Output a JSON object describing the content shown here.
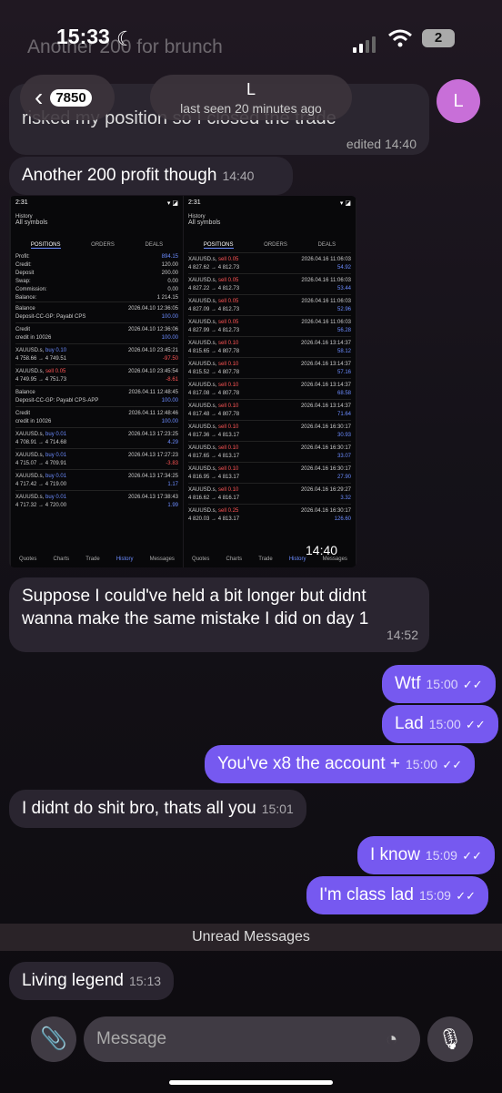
{
  "status": {
    "time": "15:33",
    "battery": "2"
  },
  "header": {
    "back_badge": "7850",
    "name": "L",
    "last_seen": "last seen 20 minutes ago",
    "avatar_letter": "L"
  },
  "ghost": {
    "line1": "Another 200 for brunch",
    "line2": "risked my position so I closed the trade",
    "edited": "edited 14:40"
  },
  "messages": [
    {
      "text": "Another 200 profit though",
      "time": "14:40"
    },
    {
      "text": "Suppose I could've held a bit longer but didnt wanna make the same mistake I did on day 1",
      "time": "14:52"
    },
    {
      "text": "Wtf",
      "time": "15:00"
    },
    {
      "text": "Lad",
      "time": "15:00"
    },
    {
      "text": "You've x8 the account +",
      "time": "15:00"
    },
    {
      "text": "I didnt do shit bro, thats all you",
      "time": "15:01"
    },
    {
      "text": "I know",
      "time": "15:09"
    },
    {
      "text": "I'm class lad",
      "time": "15:09"
    },
    {
      "text": "Living legend",
      "time": "15:13"
    }
  ],
  "screenshot": {
    "time": "14:40",
    "left": {
      "clock": "2:31",
      "title": "History",
      "subtitle": "All symbols",
      "tabs": [
        "POSITIONS",
        "ORDERS",
        "DEALS"
      ],
      "summary": [
        [
          "Profit:",
          "894.15"
        ],
        [
          "Credit:",
          "120.00"
        ],
        [
          "Deposit",
          "200.00"
        ],
        [
          "Swap:",
          "0.00"
        ],
        [
          "Commission:",
          "0.00"
        ],
        [
          "Balance:",
          "1 214.15"
        ]
      ],
      "deals": [
        {
          "a": "Balance",
          "b": "Deposit-CC-GP: Payabl CPS",
          "d": "2026.04.10 12:36:05",
          "v": "100.00"
        },
        {
          "a": "Credit",
          "b": "credit in 10026",
          "d": "2026.04.10 12:36:06",
          "v": "100.00"
        },
        {
          "a": "XAUUSD.s, buy 0.10",
          "b": "4 758.66 → 4 749.51",
          "d": "2026.04.10 23:45:21",
          "v": "-97.50"
        },
        {
          "a": "XAUUSD.s, sell 0.05",
          "b": "4 749.95 → 4 751.73",
          "d": "2026.04.10 23:45:54",
          "v": "-8.61"
        },
        {
          "a": "Balance",
          "b": "Deposit-CC-GP: Payabl CPS-APP",
          "d": "2026.04.11 12:48:45",
          "v": "100.00"
        },
        {
          "a": "Credit",
          "b": "credit in 10026",
          "d": "2026.04.11 12:48:46",
          "v": "100.00"
        },
        {
          "a": "XAUUSD.s, buy 0.01",
          "b": "4 708.91 → 4 714.68",
          "d": "2026.04.13 17:23:25",
          "v": "4.29"
        },
        {
          "a": "XAUUSD.s, buy 0.01",
          "b": "4 715.07 → 4 709.91",
          "d": "2026.04.13 17:27:23",
          "v": "-3.83"
        },
        {
          "a": "XAUUSD.s, buy 0.01",
          "b": "4 717.42 → 4 719.00",
          "d": "2026.04.13 17:34:25",
          "v": "1.17"
        },
        {
          "a": "XAUUSD.s, buy 0.01",
          "b": "4 717.32 → 4 720.00",
          "d": "2026.04.13 17:38:43",
          "v": "1.99"
        }
      ],
      "nav": [
        "Quotes",
        "Charts",
        "Trade",
        "History",
        "Messages"
      ]
    },
    "right": {
      "clock": "2:31",
      "title": "History",
      "subtitle": "All symbols",
      "tabs": [
        "POSITIONS",
        "ORDERS",
        "DEALS"
      ],
      "deals": [
        {
          "a": "XAUUSD.s, sell 0.05",
          "b": "4 827.62 → 4 812.73",
          "d": "2026.04.16 11:06:03",
          "v": "54.92"
        },
        {
          "a": "XAUUSD.s, sell 0.05",
          "b": "4 827.22 → 4 812.73",
          "d": "2026.04.16 11:06:03",
          "v": "53.44"
        },
        {
          "a": "XAUUSD.s, sell 0.05",
          "b": "4 827.09 → 4 812.73",
          "d": "2026.04.16 11:06:03",
          "v": "52.96"
        },
        {
          "a": "XAUUSD.s, sell 0.05",
          "b": "4 827.99 → 4 812.73",
          "d": "2026.04.16 11:06:03",
          "v": "56.28"
        },
        {
          "a": "XAUUSD.s, sell 0.10",
          "b": "4 815.65 → 4 807.78",
          "d": "2026.04.16 13:14:37",
          "v": "58.12"
        },
        {
          "a": "XAUUSD.s, sell 0.10",
          "b": "4 815.52 → 4 807.78",
          "d": "2026.04.16 13:14:37",
          "v": "57.16"
        },
        {
          "a": "XAUUSD.s, sell 0.10",
          "b": "4 817.08 → 4 807.78",
          "d": "2026.04.16 13:14:37",
          "v": "68.58"
        },
        {
          "a": "XAUUSD.s, sell 0.10",
          "b": "4 817.48 → 4 807.78",
          "d": "2026.04.16 13:14:37",
          "v": "71.64"
        },
        {
          "a": "XAUUSD.s, sell 0.10",
          "b": "4 817.36 → 4 813.17",
          "d": "2026.04.16 16:30:17",
          "v": "30.93"
        },
        {
          "a": "XAUUSD.s, sell 0.10",
          "b": "4 817.65 → 4 813.17",
          "d": "2026.04.16 16:30:17",
          "v": "33.07"
        },
        {
          "a": "XAUUSD.s, sell 0.10",
          "b": "4 816.95 → 4 813.17",
          "d": "2026.04.16 16:30:17",
          "v": "27.90"
        },
        {
          "a": "XAUUSD.s, sell 0.10",
          "b": "4 816.62 → 4 816.17",
          "d": "2026.04.16 16:29:27",
          "v": "3.32"
        },
        {
          "a": "XAUUSD.s, sell 0.25",
          "b": "4 820.03 → 4 813.17",
          "d": "2026.04.16 16:30:17",
          "v": "126.60"
        }
      ],
      "nav": [
        "Quotes",
        "Charts",
        "Trade",
        "History",
        "Messages"
      ]
    }
  },
  "unread": "Unread Messages",
  "input": {
    "placeholder": "Message"
  },
  "colors": {
    "outgoing": "#7659f0",
    "incoming": "#2a2530",
    "avatar": "#c86fd8"
  }
}
